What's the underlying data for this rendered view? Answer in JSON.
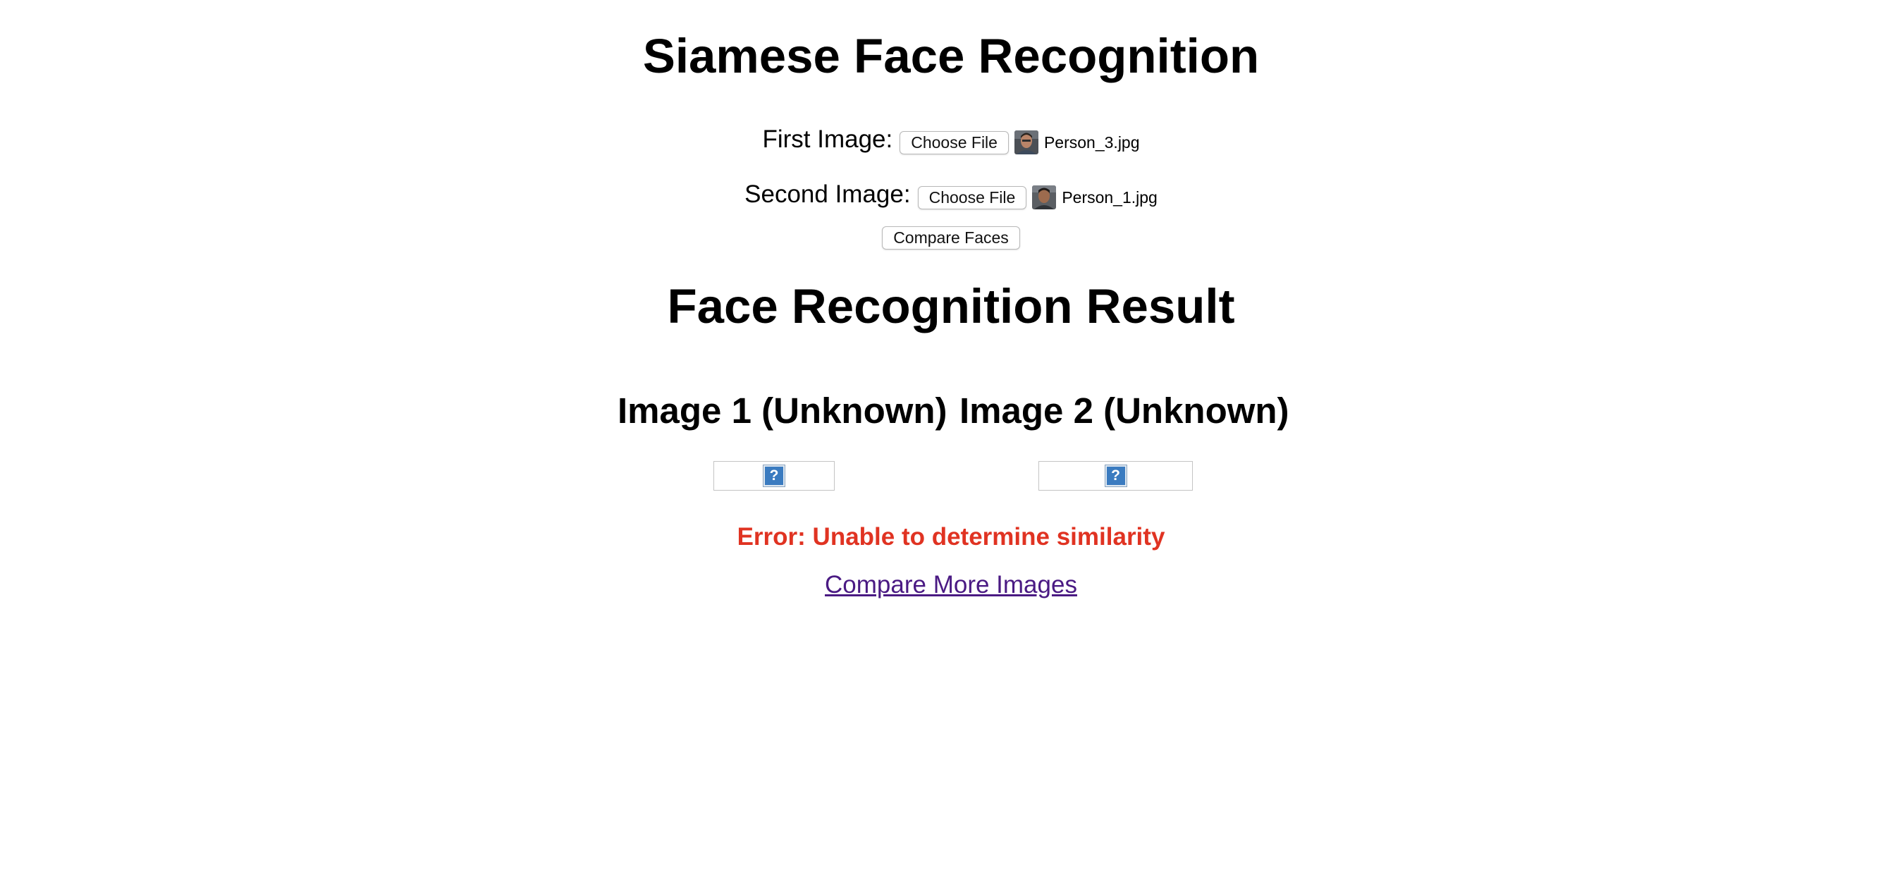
{
  "page_title": "Siamese Face Recognition",
  "form": {
    "first": {
      "label": "First Image:",
      "button_label": "Choose File",
      "file_name": "Person_3.jpg"
    },
    "second": {
      "label": "Second Image:",
      "button_label": "Choose File",
      "file_name": "Person_1.jpg"
    },
    "submit_label": "Compare Faces"
  },
  "result": {
    "title": "Face Recognition Result",
    "image1_heading": "Image 1 (Unknown)",
    "image2_heading": "Image 2 (Unknown)",
    "broken_image_glyph": "?",
    "error_message": "Error: Unable to determine similarity",
    "link_label": "Compare More Images"
  },
  "colors": {
    "error": "#e03322",
    "visited_link": "#4a1a83",
    "broken_image_icon": "#3a7bc0"
  }
}
